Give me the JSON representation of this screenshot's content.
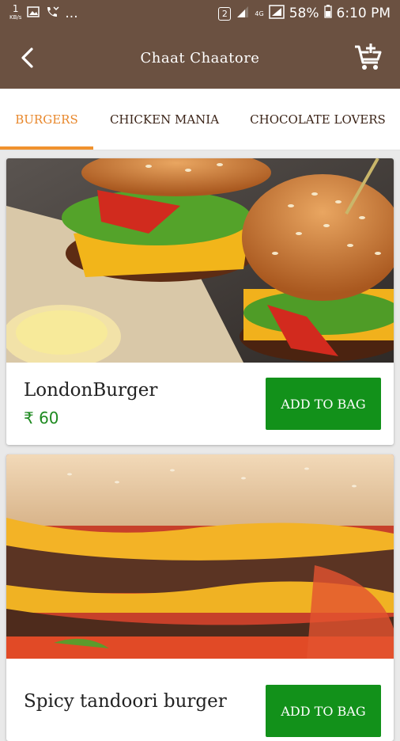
{
  "status_bar": {
    "left_icons": [
      "network-speed-icon",
      "image-notification-icon",
      "missed-call-icon",
      "more-notifications-icon"
    ],
    "network_speed_value": "1",
    "network_speed_unit": "KB/s",
    "more": "...",
    "sim_badge": "2",
    "network_type": "4G",
    "battery": "58%",
    "time": "6:10 PM"
  },
  "header": {
    "title": "Chaat Chaatore",
    "back_icon": "back-arrow-icon",
    "cart_icon": "add-to-cart-icon"
  },
  "tabs": [
    {
      "label": "BURGERS",
      "active": true
    },
    {
      "label": "CHICKEN MANIA",
      "active": false
    },
    {
      "label": "CHOCOLATE LOVERS",
      "active": false
    }
  ],
  "products": [
    {
      "name": "LondonBurger",
      "price": "₹ 60",
      "button": "ADD TO BAG"
    },
    {
      "name": "Spicy tandoori burger",
      "price": "",
      "button": "ADD TO BAG"
    }
  ],
  "colors": {
    "header": "#6b5141",
    "tab_active": "#e8872b",
    "tab_text": "#3b2418",
    "button": "#12911a",
    "price": "#1e8a20"
  }
}
